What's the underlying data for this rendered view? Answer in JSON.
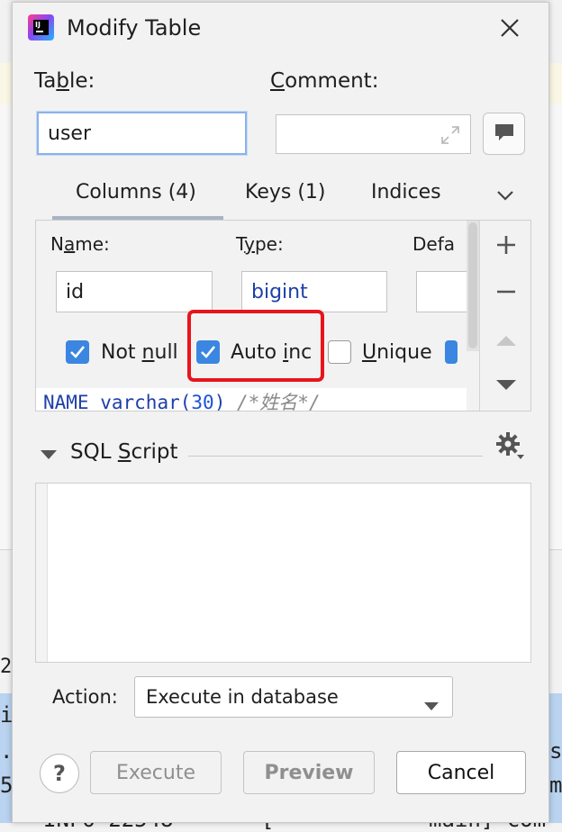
{
  "dialog": {
    "title": "Modify Table",
    "app_icon": "intellij-idea-icon",
    "close_icon": "close-icon"
  },
  "table_field": {
    "label": "Table:",
    "value": "user"
  },
  "comment_field": {
    "label": "Comment:",
    "value": "",
    "expand_icon": "expand-icon",
    "edit_icon": "comment-bubble-icon"
  },
  "tabs": [
    {
      "label": "Columns (4)",
      "selected": true
    },
    {
      "label": "Keys (1)",
      "selected": false
    },
    {
      "label": "Indices",
      "selected": false
    }
  ],
  "tabs_more_icon": "chevron-down-icon",
  "column_editor": {
    "name_label": "Name:",
    "name_value": "id",
    "type_label": "Type:",
    "type_value": "bigint",
    "default_label": "Defa",
    "default_value": "",
    "checkboxes": [
      {
        "label": "Not null",
        "checked": true
      },
      {
        "label": "Auto inc",
        "checked": true
      },
      {
        "label": "Unique",
        "checked": false
      }
    ],
    "sql_preview": {
      "col": "NAME",
      "type": "varchar",
      "size": "30",
      "comment": "/*姓名*/"
    }
  },
  "side_tools": [
    "add-icon",
    "remove-icon",
    "move-up-icon",
    "move-down-icon"
  ],
  "sql_script": {
    "title": "SQL Script",
    "settings_icon": "gear-icon",
    "content": ""
  },
  "action": {
    "label": "Action:",
    "value": "Execute in database"
  },
  "buttons": {
    "help": "?",
    "execute": "Execute",
    "preview": "Preview",
    "cancel": "Cancel"
  },
  "background": {
    "console_lines": [
      "i",
      ".",
      "5",
      "INFO 22548",
      "[",
      "main] com",
      "s",
      "m",
      "2"
    ]
  },
  "colors": {
    "checkbox_on": "#3b86e0",
    "highlight": "#e8141c",
    "type_text": "#1e3fa8"
  }
}
